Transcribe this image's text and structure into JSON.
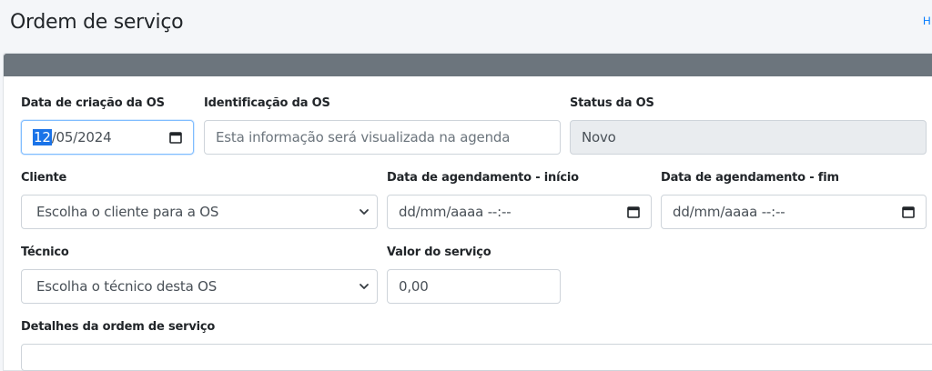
{
  "header": {
    "title": "Ordem de serviço",
    "breadcrumb": "H"
  },
  "form": {
    "created_label": "Data de criação da OS",
    "created_day": "12",
    "created_rest": "/05/2024",
    "ident_label": "Identificação da OS",
    "ident_placeholder": "Esta informação será visualizada na agenda",
    "status_label": "Status da OS",
    "status_value": "Novo",
    "client_label": "Cliente",
    "client_selected": "Escolha o cliente para a OS",
    "start_label": "Data de agendamento - início",
    "start_value": "dd/mm/aaaa --:--",
    "end_label": "Data de agendamento - fim",
    "end_value": "dd/mm/aaaa --:--",
    "tech_label": "Técnico",
    "tech_selected": "Escolha o técnico desta OS",
    "value_label": "Valor do serviço",
    "value_value": "0,00",
    "details_label": "Detalhes da ordem de serviço"
  },
  "icons": {
    "calendar": "calendar-icon",
    "chevron": "chevron-down-icon"
  },
  "colors": {
    "card_header": "#6c757d",
    "link": "#007bff",
    "focus": "#80bdff",
    "readonly_bg": "#e9ecef"
  }
}
